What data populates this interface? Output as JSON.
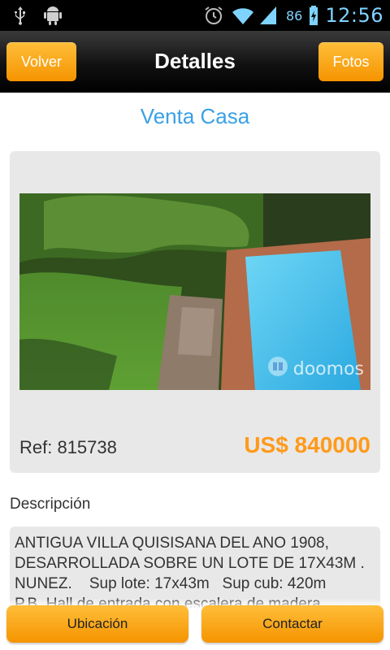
{
  "status_bar": {
    "battery_percent": "86",
    "clock": "12:56",
    "icons": [
      "usb-icon",
      "android-debug-icon",
      "alarm-icon",
      "wifi-icon",
      "signal-icon",
      "battery-charging-icon"
    ]
  },
  "header": {
    "back_label": "Volver",
    "title": "Detalles",
    "photos_label": "Fotos"
  },
  "listing": {
    "title": "Venta Casa",
    "ref": "Ref: 815738",
    "price": "US$ 840000",
    "photo_watermark": "doomos"
  },
  "description": {
    "label": "Descripción",
    "text": "ANTIGUA VILLA QUISISANA DEL ANO 1908,\nDESARROLLADA SOBRE UN LOTE DE 17X43M .\nNUNEZ.    Sup lote: 17x43m   Sup cub: 420m\nP.B. Hall de entrada con escalera de madera"
  },
  "actions": {
    "location_label": "Ubicación",
    "contact_label": "Contactar"
  },
  "colors": {
    "accent_orange": "#f59400",
    "title_blue": "#3aa0e6",
    "price_orange": "#ff9a1a"
  }
}
